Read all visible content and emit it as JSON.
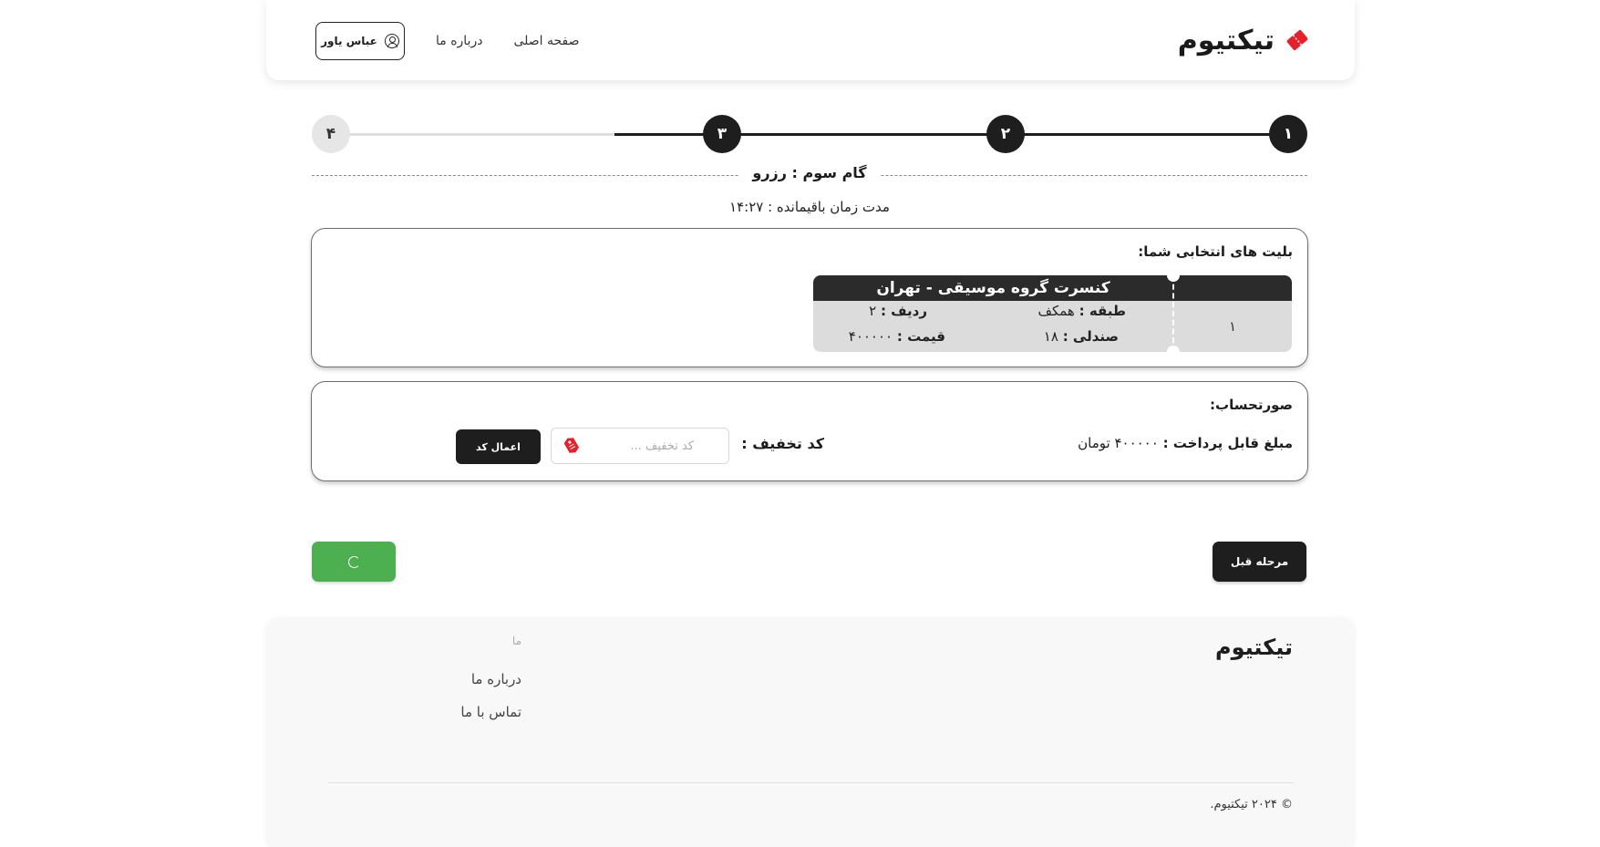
{
  "header": {
    "logo_text": "تیکتیوم",
    "nav": {
      "home": "صفحه اصلی",
      "about": "درباره ما"
    },
    "user_name": "عباس یاور"
  },
  "stepper": {
    "steps": [
      "۱",
      "۲",
      "۳",
      "۴"
    ],
    "current_step": 3,
    "title": "گام سوم : رزرو",
    "timer": "مدت زمان باقیمانده : ۱۴:۲۷"
  },
  "tickets": {
    "title": "بلیت های انتخابی شما:",
    "items": [
      {
        "number": "۱",
        "event": "کنسرت گروه موسیقی - تهران",
        "floor_label": "طبقه :",
        "floor_value": "همکف",
        "row_label": "ردیف :",
        "row_value": "۲",
        "seat_label": "صندلی :",
        "seat_value": "۱۸",
        "price_label": "قیمت :",
        "price_value": "۴۰۰۰۰۰"
      }
    ]
  },
  "invoice": {
    "title": "صورتحساب:",
    "amount_label": "مبلغ قابل پرداخت :",
    "amount_value": "۴۰۰۰۰۰ تومان",
    "discount_label": "کد تخفیف :",
    "discount_placeholder": "کد تخفیف ...",
    "discount_value": "",
    "apply_label": "اعمال کد"
  },
  "actions": {
    "prev_label": "مرحله قبل",
    "next_state": "loading"
  },
  "footer": {
    "brand": "تیکتیوم",
    "links_heading": "ما",
    "links": [
      "درباره ما",
      "تماس با ما"
    ],
    "copyright": "© ۲۰۲۴ تیکتیوم."
  },
  "colors": {
    "accent_red": "#e8202a",
    "dark": "#1e1e1e",
    "success": "#4caf50",
    "step_inactive": "#e6e6e6"
  },
  "icons": {
    "logo": "ticket-logo-icon",
    "user": "user-circle-icon",
    "discount": "tag-icon",
    "loading": "spinner-icon"
  }
}
